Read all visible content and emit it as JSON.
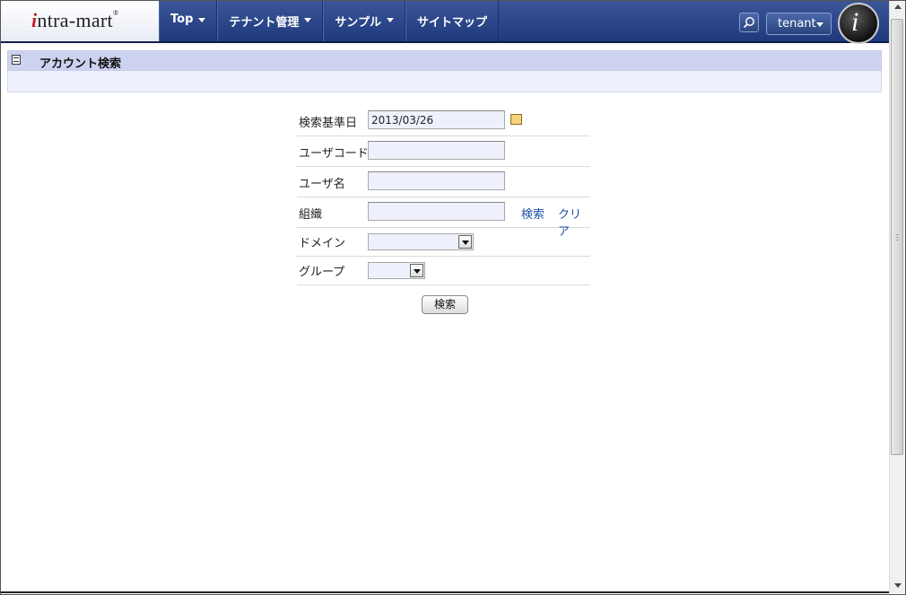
{
  "header": {
    "logo": {
      "prefix": "i",
      "text": "ntra-mart",
      "reg": "®"
    },
    "nav": [
      {
        "label": "Top",
        "has_dropdown": true
      },
      {
        "label": "テナント管理",
        "has_dropdown": true
      },
      {
        "label": "サンプル",
        "has_dropdown": true
      },
      {
        "label": "サイトマップ",
        "has_dropdown": false
      }
    ],
    "search_icon": "search-icon",
    "tenant_label": "tenant",
    "badge_letter": "i"
  },
  "page": {
    "title": "アカウント検索",
    "title_icon": "window-icon"
  },
  "form": {
    "date_label": "検索基準日",
    "date_value": "2013/03/26",
    "calendar_icon": "calendar-icon",
    "user_code_label": "ユーザコード",
    "user_code_value": "",
    "user_name_label": "ユーザ名",
    "user_name_value": "",
    "org_label": "組織",
    "org_value": "",
    "org_search_link": "検索",
    "org_clear_link": "クリア",
    "domain_label": "ドメイン",
    "domain_value": "",
    "group_label": "グループ",
    "group_value": "",
    "submit_label": "検索"
  },
  "colors": {
    "header_bg": "#2a4585",
    "title_bar_bg": "#cdd2f0",
    "input_bg": "#eef0fb",
    "link": "#1d4fa6"
  }
}
